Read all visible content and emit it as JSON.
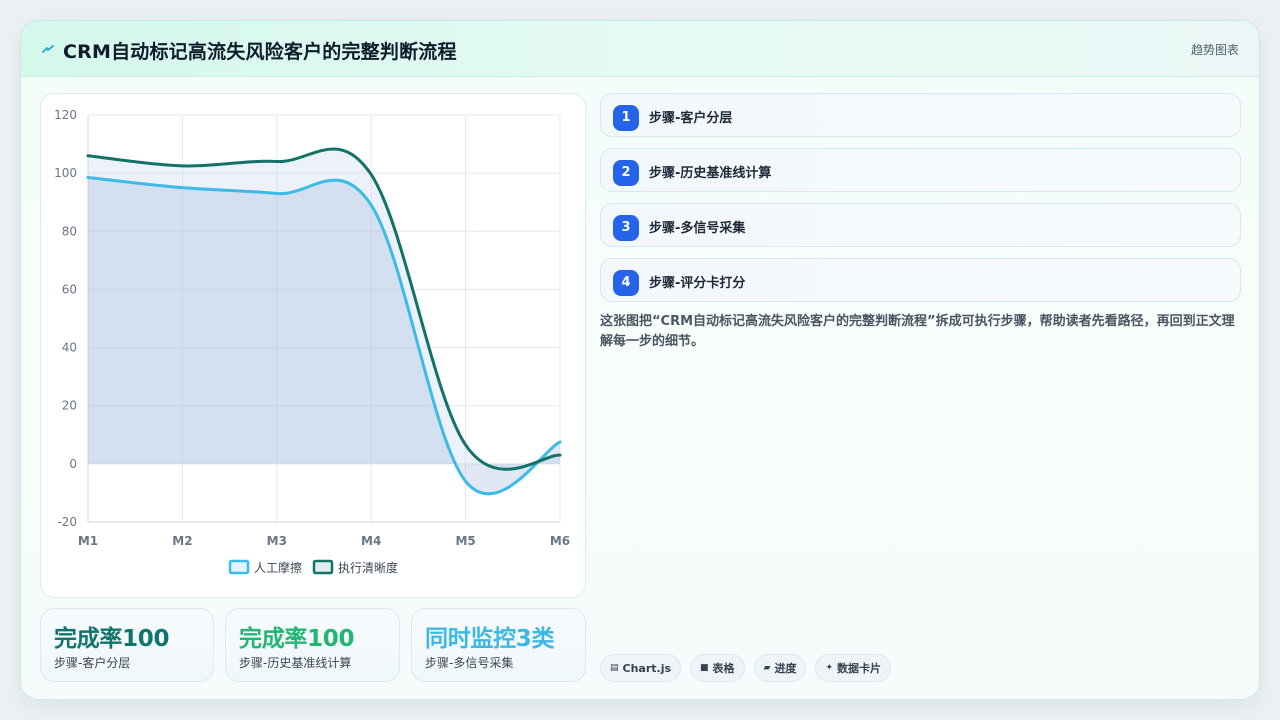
{
  "header": {
    "title": "CRM自动标记高流失风险客户的完整判断流程",
    "badge": "趋势图表"
  },
  "chart_data": {
    "type": "line",
    "categories": [
      "M1",
      "M2",
      "M3",
      "M4",
      "M5",
      "M6"
    ],
    "series": [
      {
        "name": "人工摩擦",
        "values": [
          98.5,
          95,
          93,
          89,
          -6,
          7.5
        ],
        "color": "#3dbbe8",
        "fill": true
      },
      {
        "name": "执行清晰度",
        "values": [
          106,
          102.5,
          104,
          99.5,
          6.5,
          3
        ],
        "color": "#137268",
        "fill": false
      }
    ],
    "ylim": [
      -20,
      120
    ],
    "yticks": [
      -20,
      0,
      20,
      40,
      60,
      80,
      100,
      120
    ],
    "grid": true,
    "legend": "bottom"
  },
  "stats": [
    {
      "value": "完成率100",
      "label": "步骤-客户分层",
      "color": "#0f766e"
    },
    {
      "value": "完成率100",
      "label": "步骤-历史基准线计算",
      "color": "#22b573"
    },
    {
      "value": "同时监控3类",
      "label": "步骤-多信号采集",
      "color": "#3cb8e6"
    }
  ],
  "steps": [
    {
      "num": "1",
      "label": "步骤-客户分层"
    },
    {
      "num": "2",
      "label": "步骤-历史基准线计算"
    },
    {
      "num": "3",
      "label": "步骤-多信号采集"
    },
    {
      "num": "4",
      "label": "步骤-评分卡打分"
    }
  ],
  "description": "这张图把“CRM自动标记高流失风险客户的完整判断流程”拆成可执行步骤，帮助读者先看路径，再回到正文理解每一步的细节。",
  "tags": [
    {
      "icon": "chart-icon",
      "glyph": "▤",
      "label": "Chart.js"
    },
    {
      "icon": "table-icon",
      "glyph": "■",
      "label": "表格"
    },
    {
      "icon": "progress-icon",
      "glyph": "▰",
      "label": "进度"
    },
    {
      "icon": "sparkle-icon",
      "glyph": "✦",
      "label": "数据卡片"
    }
  ]
}
